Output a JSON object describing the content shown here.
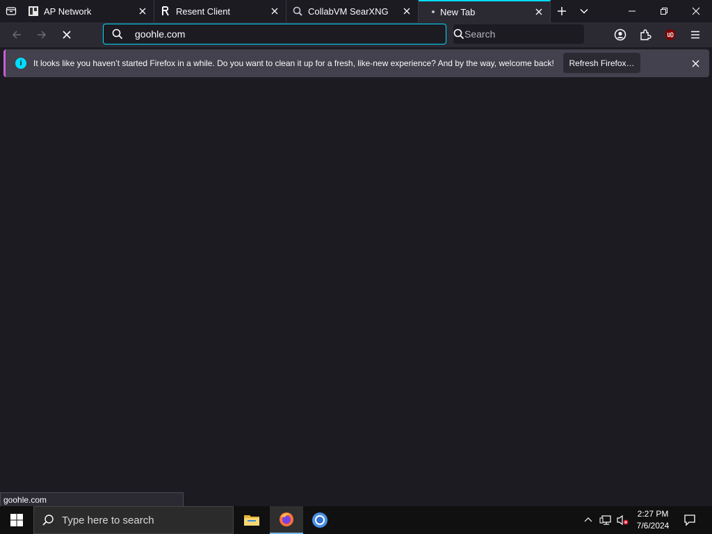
{
  "browser": {
    "tabs": [
      {
        "title": "AP Network",
        "favicon": "ap-network-icon",
        "active": false
      },
      {
        "title": "Resent Client",
        "favicon": "resent-client-icon",
        "active": false
      },
      {
        "title": "CollabVM SearXNG",
        "favicon": "searxng-icon",
        "active": false
      },
      {
        "title": "New Tab",
        "favicon": "loading-dot",
        "active": true
      }
    ],
    "urlbar": {
      "value": "goohle.com"
    },
    "searchbar": {
      "placeholder": "Search"
    },
    "accent_color": "#00ddff"
  },
  "notification": {
    "message": "It looks like you haven’t started Firefox in a while. Do you want to clean it up for a fresh, like-new experience? And by the way, welcome back!",
    "button_label": "Refresh Firefox…",
    "info_glyph": "i"
  },
  "status_panel": {
    "text": "goohle.com"
  },
  "taskbar": {
    "search_placeholder": "Type here to search",
    "clock_time": "2:27 PM",
    "clock_date": "7/6/2024"
  }
}
